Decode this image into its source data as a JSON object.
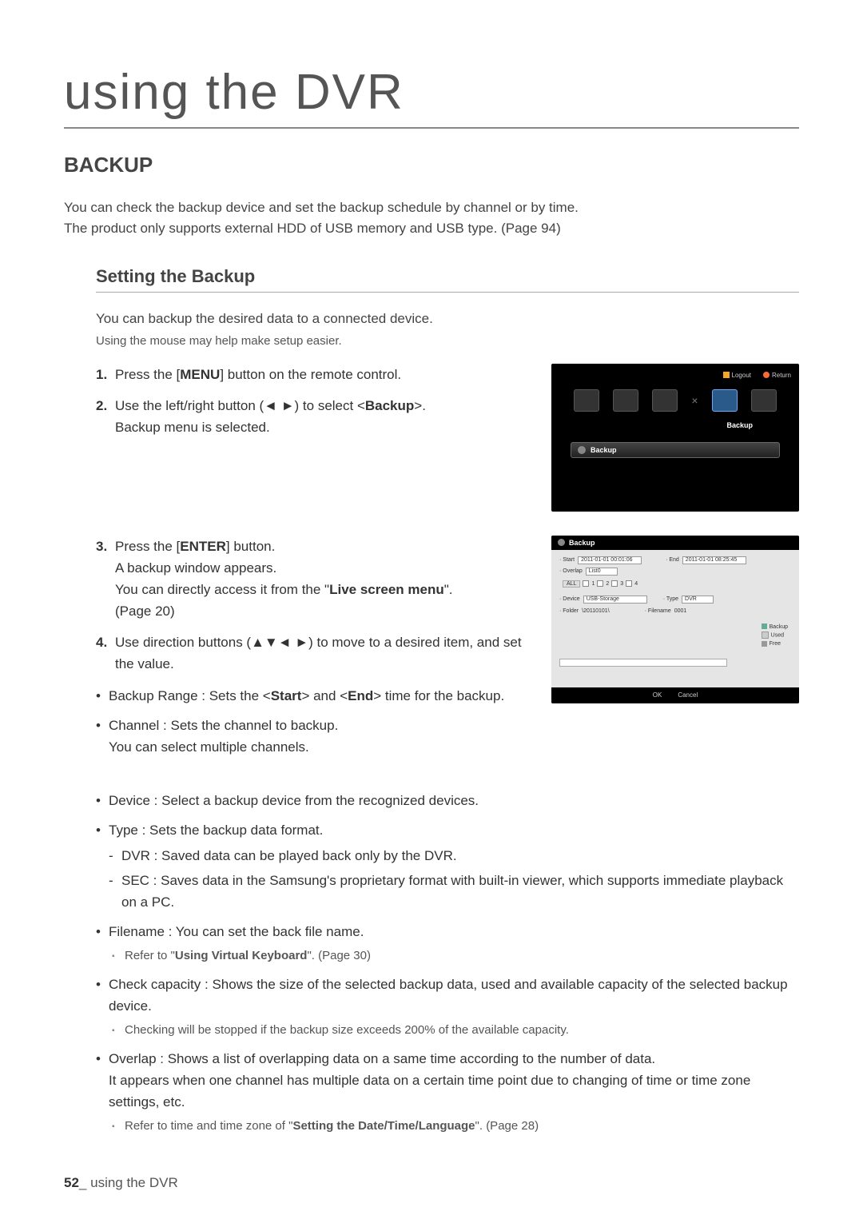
{
  "page": {
    "big_title": "using the DVR",
    "section_title": "BACKUP",
    "intro_line1": "You can check the backup device and set the backup schedule by channel or by time.",
    "intro_line2": "The product only supports external HDD of USB memory and USB type. (Page 94)",
    "sub_title": "Setting the Backup",
    "desc1": "You can backup the desired data to a connected device.",
    "note1": "Using the mouse may help make setup easier.",
    "step1_pre": "Press the [",
    "step1_bold": "MENU",
    "step1_post": "] button on the remote control.",
    "step2_pre": "Use the left/right button (◄ ►) to select <",
    "step2_bold": "Backup",
    "step2_post": ">.",
    "step2_line2": "Backup menu is selected.",
    "step3_pre": "Press the [",
    "step3_bold": "ENTER",
    "step3_post": "] button.",
    "step3_line2": "A backup window appears.",
    "step3_line3_pre": "You can directly access it from the \"",
    "step3_line3_bold": "Live screen menu",
    "step3_line3_post": "\".",
    "step3_line4": "(Page 20)",
    "step4": "Use direction buttons (▲▼◄ ►) to move to a desired item, and set the value.",
    "b1_pre": "Backup Range : Sets the <",
    "b1_b1": "Start",
    "b1_mid": "> and <",
    "b1_b2": "End",
    "b1_post": "> time for the backup.",
    "b2_l1": "Channel : Sets the channel to backup.",
    "b2_l2": "You can select multiple channels.",
    "b3": "Device : Select a backup device from the recognized devices.",
    "b4": "Type : Sets the backup data format.",
    "b4_s1": "DVR : Saved data can be played back only by the DVR.",
    "b4_s2": "SEC : Saves data in the Samsung's proprietary format with built-in viewer, which supports immediate playback on a PC.",
    "b5": "Filename : You can set the back file name.",
    "b5_n_pre": "Refer to \"",
    "b5_n_bold": "Using Virtual Keyboard",
    "b5_n_post": "\". (Page 30)",
    "b6": "Check capacity : Shows the size of the selected backup data, used and available capacity of the selected backup device.",
    "b6_n": "Checking will be stopped if the backup size exceeds 200% of the available capacity.",
    "b7_l1": "Overlap : Shows a list of overlapping data on a same time according to the number of data.",
    "b7_l2": "It appears when one channel has multiple data on a certain time point due to changing of time or time zone settings, etc.",
    "b7_n_pre": "Refer to time and time zone of \"",
    "b7_n_bold": "Setting the Date/Time/Language",
    "b7_n_post": "\". (Page 28)"
  },
  "screenshot1": {
    "logout": "Logout",
    "return": "Return",
    "backup_label": "Backup",
    "menu_item": "Backup"
  },
  "screenshot2": {
    "title": "Backup",
    "start_label": "· Start",
    "start_value": "2011-01-01 00:01:06",
    "end_label": "· End",
    "end_value": "2011-01-01 08:25:45",
    "overlap_label": "· Overlap",
    "overlap_value": "List0",
    "all": "ALL",
    "ch1": "1",
    "ch2": "2",
    "ch3": "3",
    "ch4": "4",
    "device_label": "· Device",
    "device_value": "USB-Storage",
    "type_label": "· Type",
    "type_value": "DVR",
    "folder_label": "· Folder",
    "folder_value": "\\20110101\\",
    "filename_label": "· Filename",
    "filename_value": "0001",
    "legend_backup": "Backup",
    "legend_used": "Used",
    "legend_free": "Free",
    "ok": "OK",
    "cancel": "Cancel"
  },
  "footer": {
    "page_num": "52",
    "sep": "_",
    "text": "using the DVR"
  }
}
